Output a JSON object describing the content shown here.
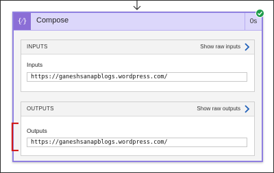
{
  "action": {
    "icon": "compose-braces-icon",
    "icon_glyph": "{⁄}",
    "title": "Compose",
    "duration": "0s",
    "status": "succeeded"
  },
  "inputs": {
    "section_title": "INPUTS",
    "raw_link": "Show raw inputs",
    "field_label": "Inputs",
    "field_value": "https://ganeshsanapblogs.wordpress.com/"
  },
  "outputs": {
    "section_title": "OUTPUTS",
    "raw_link": "Show raw outputs",
    "field_label": "Outputs",
    "field_value": "https://ganeshsanapblogs.wordpress.com/"
  },
  "colors": {
    "accent": "#8b6ed6",
    "header_bg": "#dcd7fb",
    "success": "#1e9b4a",
    "link_chevron": "#1f5fb8",
    "annotation": "#d21a1a"
  }
}
